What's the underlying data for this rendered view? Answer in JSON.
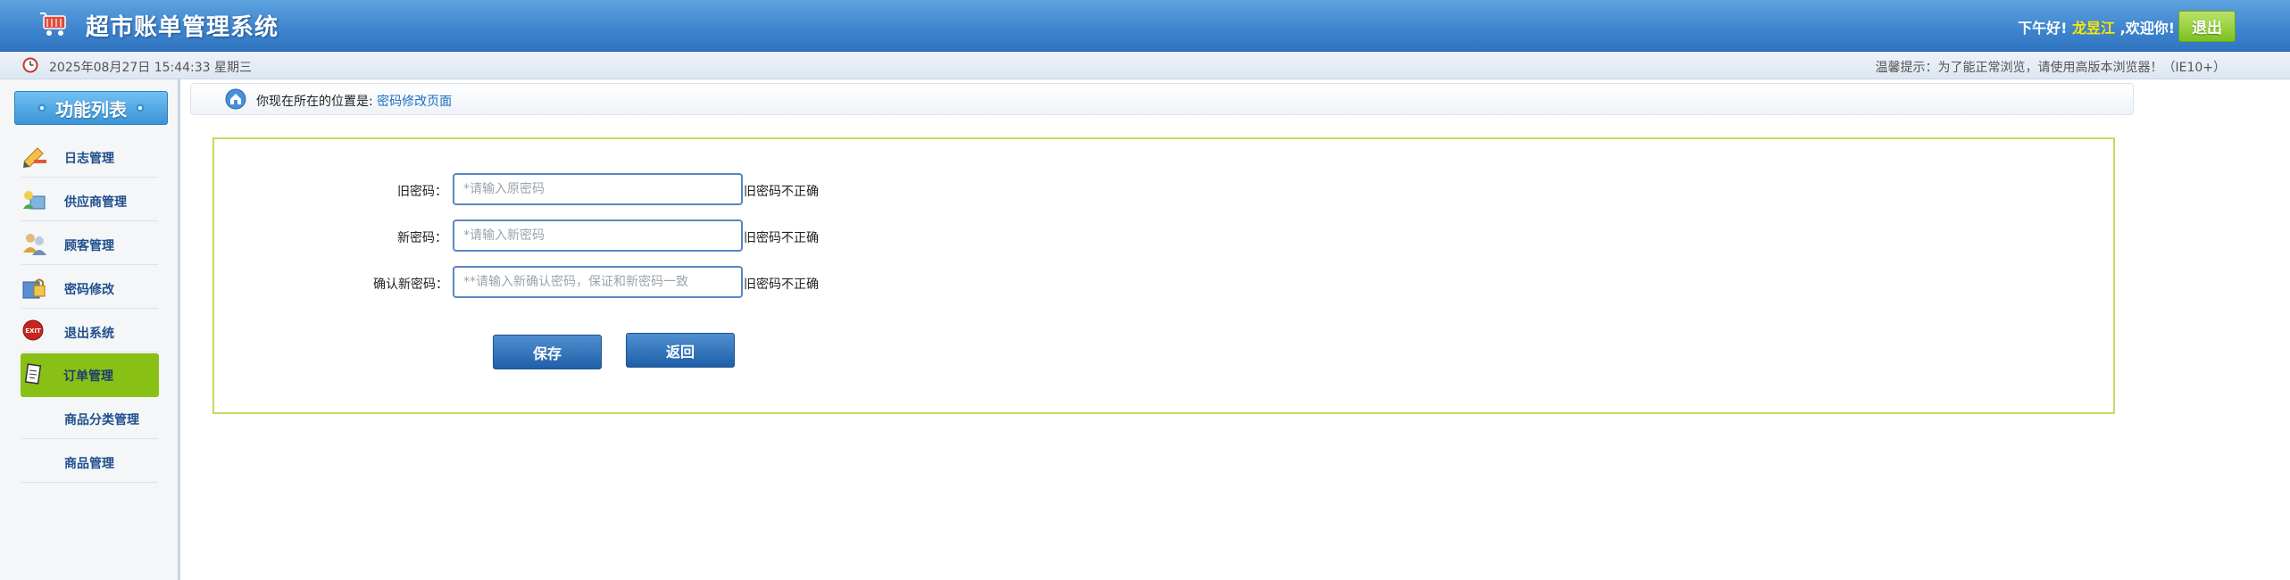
{
  "header": {
    "title": "超市账单管理系统",
    "greeting_prefix": "下午好! ",
    "username": "龙昱江",
    "greeting_suffix": " ,欢迎你!",
    "logout_label": "退出",
    "logo_icon": "shopping-cart-icon"
  },
  "status_bar": {
    "datetime": "2025年08月27日 15:44:33 星期三",
    "tip": "温馨提示：为了能正常浏览，请使用高版本浏览器！（IE10+）"
  },
  "sidebar": {
    "title": "功能列表",
    "items": [
      {
        "label": "日志管理",
        "icon": "log-icon",
        "active": false
      },
      {
        "label": "供应商管理",
        "icon": "supplier-icon",
        "active": false
      },
      {
        "label": "顾客管理",
        "icon": "customer-icon",
        "active": false
      },
      {
        "label": "密码修改",
        "icon": "password-icon",
        "active": false
      },
      {
        "label": "退出系统",
        "icon": "exit-icon",
        "active": false
      },
      {
        "label": "订单管理",
        "icon": "order-icon",
        "active": true
      },
      {
        "label": "商品分类管理",
        "icon": "",
        "active": false
      },
      {
        "label": "商品管理",
        "icon": "",
        "active": false
      }
    ]
  },
  "breadcrumb": {
    "prefix": "你现在所在的位置是: ",
    "current": "密码修改页面"
  },
  "form": {
    "old_password": {
      "label": "旧密码：",
      "placeholder": "*请输入原密码",
      "value": "",
      "error": "旧密码不正确"
    },
    "new_password": {
      "label": "新密码：",
      "placeholder": "*请输入新密码",
      "value": "",
      "error": "旧密码不正确"
    },
    "confirm_password": {
      "label": "确认新密码：",
      "placeholder": "**请输入新确认密码，保证和新密码一致",
      "value": "",
      "error": "旧密码不正确"
    },
    "save_label": "保存",
    "back_label": "返回"
  },
  "colors": {
    "header_blue": "#3f86cf",
    "active_menu_green": "#89c016",
    "logout_green": "#7cc21e",
    "panel_border": "#c4dc5f",
    "username_yellow": "#ffe600"
  }
}
